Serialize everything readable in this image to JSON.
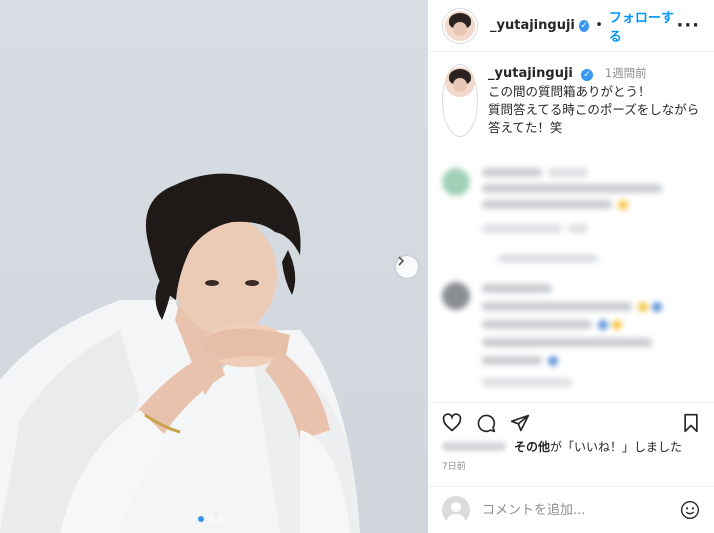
{
  "post": {
    "username": "_yutajinguji",
    "separator": "•",
    "follow_label": "フォローする",
    "more_icon": "more-horizontal-icon"
  },
  "caption": {
    "username": "_yutajinguji",
    "time": "1週間前",
    "lines": [
      "この間の質問箱ありがとう！",
      "質問答えてる時このポーズをしながら",
      "答えてた！笑"
    ]
  },
  "likes": {
    "others_label": "その他",
    "suffix": "が「いいね！」しました"
  },
  "date": "7日前",
  "comment_box": {
    "placeholder": "コメントを追加..."
  },
  "carousel": {
    "dot_count": 3,
    "active_index": 1
  },
  "colors": {
    "accent": "#0095f6",
    "verified": "#3897f0"
  }
}
